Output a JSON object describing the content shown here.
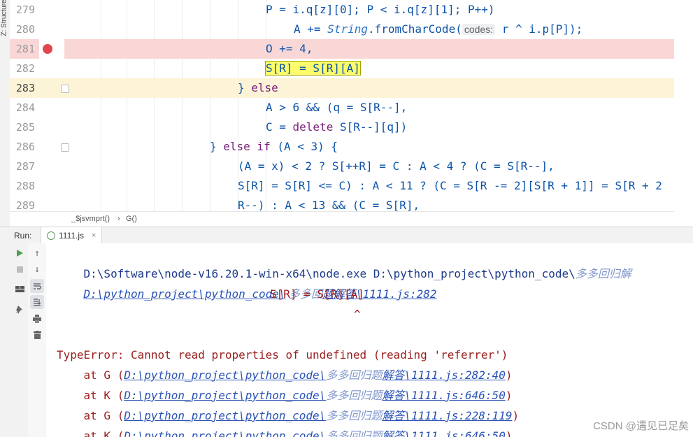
{
  "structure_tab": {
    "label": "Z: Structure"
  },
  "editor": {
    "lines": [
      {
        "no": "279",
        "tokens": [
          {
            "t": "P = i.q[z][0]; P < i.q[z][1]; P++)"
          }
        ]
      },
      {
        "no": "280",
        "tokens": [
          {
            "t": "A += "
          },
          {
            "t": "String",
            "cls": "it"
          },
          {
            "t": ".fromCharCode("
          },
          {
            "t": "codes:",
            "cls": "hint"
          },
          {
            "t": " r ^ i.p[P]);"
          }
        ]
      },
      {
        "no": "281",
        "tokens": [
          {
            "t": "O += 4"
          },
          {
            "t": ","
          }
        ]
      },
      {
        "no": "282",
        "tokens": [
          {
            "t": "S[R] = S[R][A]",
            "cls": "hl-box"
          }
        ]
      },
      {
        "no": "283",
        "tokens": [
          {
            "t": "} "
          },
          {
            "t": "else",
            "cls": "kw"
          }
        ]
      },
      {
        "no": "284",
        "tokens": [
          {
            "t": "A > 6 && (q = S[R--]"
          },
          {
            "t": ","
          }
        ]
      },
      {
        "no": "285",
        "tokens": [
          {
            "t": "C = "
          },
          {
            "t": "delete",
            "cls": "kw"
          },
          {
            "t": " S[R--][q])"
          }
        ]
      },
      {
        "no": "286",
        "tokens": [
          {
            "t": "} "
          },
          {
            "t": "else if",
            "cls": "kw"
          },
          {
            "t": " (A < 3) {"
          }
        ]
      },
      {
        "no": "287",
        "tokens": [
          {
            "t": "(A = x) < 2 ? S[++R] = C : A < 4 ? (C = S[R--]"
          },
          {
            "t": ","
          }
        ]
      },
      {
        "no": "288",
        "tokens": [
          {
            "t": "S[R] = S[R] <= C) : A < 11 ? (C = S[R -= 2][S[R + 1]] = S[R + 2"
          }
        ]
      },
      {
        "no": "289",
        "tokens": [
          {
            "t": "R--) : A < 13 && (C = S[R]"
          },
          {
            "t": ","
          }
        ]
      }
    ]
  },
  "breadcrumb": {
    "fn1": "_$jsvmprt()",
    "sep": "›",
    "fn2": "G()"
  },
  "run": {
    "label": "Run:",
    "tab_name": "1111.js",
    "close": "×"
  },
  "console": {
    "cmd_prefix": "D:\\Software\\node-v16.20.1-win-x64\\node.exe D:\\python_project\\python_code\\",
    "cmd_garble": "多多回归解",
    "path_link_a": "D:\\python_project\\python_code\\",
    "path_garble1": " 多多回",
    "path_link_b": "题解答\\1111.js:282",
    "source_line": "S[R] = S[R][A]",
    "caret": "^",
    "error": "TypeError: Cannot read properties of undefined (reading 'referrer')",
    "frames": [
      {
        "prefix": "    at G (",
        "link": "D:\\python_project\\python_code\\",
        "garble": "多多回归题",
        "tail": "解答\\1111.js:282:40",
        "close": ")"
      },
      {
        "prefix": "    at K (",
        "link": "D:\\python_project\\python_code\\",
        "garble": "多多回归题",
        "tail": "解答\\1111.js:646:50",
        "close": ")"
      },
      {
        "prefix": "    at G (",
        "link": "D:\\python_project\\python_code\\",
        "garble": "多多回归题",
        "tail": "解答\\1111.js:228:119",
        "close": ")"
      },
      {
        "prefix": "    at K (",
        "link": "D:\\python_project\\python_code\\",
        "garble": "多多回归题",
        "tail": "解答\\1111.js:646:50",
        "close": ")"
      }
    ]
  },
  "watermark": "CSDN @遇见已足矣",
  "icons": [
    "run-icon",
    "stop-icon",
    "layout-icon",
    "pin-icon",
    "up-arrow-icon",
    "down-arrow-icon",
    "soft-wrap-icon",
    "scroll-end-icon",
    "print-icon",
    "trash-icon",
    "breakpoint-icon",
    "fold-icon"
  ]
}
